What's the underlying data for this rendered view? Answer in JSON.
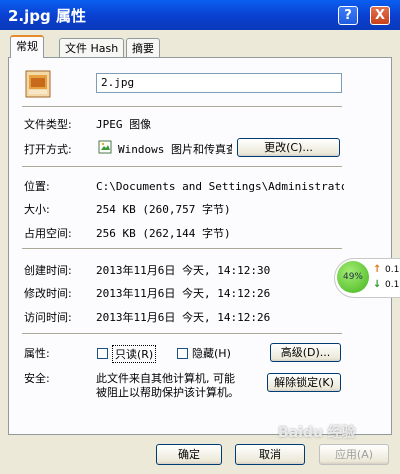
{
  "title": "2.jpg 属性",
  "titlebar_buttons": {
    "help": "?",
    "close": "X"
  },
  "tabs": [
    {
      "label": "常规",
      "active": true
    },
    {
      "label": "文件 Hash",
      "active": false
    },
    {
      "label": "摘要",
      "active": false
    }
  ],
  "filename": "2.jpg",
  "type": {
    "label": "文件类型:",
    "value": "JPEG 图像"
  },
  "open_with": {
    "label": "打开方式:",
    "value": "Windows 图片和传真查",
    "button": "更改(C)..."
  },
  "location": {
    "label": "位置:",
    "value": "C:\\Documents and Settings\\Administrator\\桌"
  },
  "size": {
    "label": "大小:",
    "value": "254 KB (260,757 字节)"
  },
  "size_on_disk": {
    "label": "占用空间:",
    "value": "256 KB (262,144 字节)"
  },
  "created": {
    "label": "创建时间:",
    "value": "2013年11月6日 今天, 14:12:30"
  },
  "modified": {
    "label": "修改时间:",
    "value": "2013年11月6日 今天, 14:12:26"
  },
  "accessed": {
    "label": "访问时间:",
    "value": "2013年11月6日 今天, 14:12:26"
  },
  "attributes": {
    "label": "属性:",
    "readonly": "只读(R)",
    "hidden": "隐藏(H)",
    "advanced": "高级(D)..."
  },
  "security": {
    "label": "安全:",
    "text_line1": "此文件来自其他计算机, 可能",
    "text_line2": "被阻止以帮助保护该计算机。",
    "unblock": "解除锁定(K)"
  },
  "buttons": {
    "ok": "确定",
    "cancel": "取消",
    "apply": "应用(A)"
  },
  "speed_widget": {
    "percent": "49%",
    "up": "0.1",
    "down": "0.1",
    "up_color": "#e07a10",
    "down_color": "#2c9a2c"
  },
  "watermark": "Baidu 经验"
}
